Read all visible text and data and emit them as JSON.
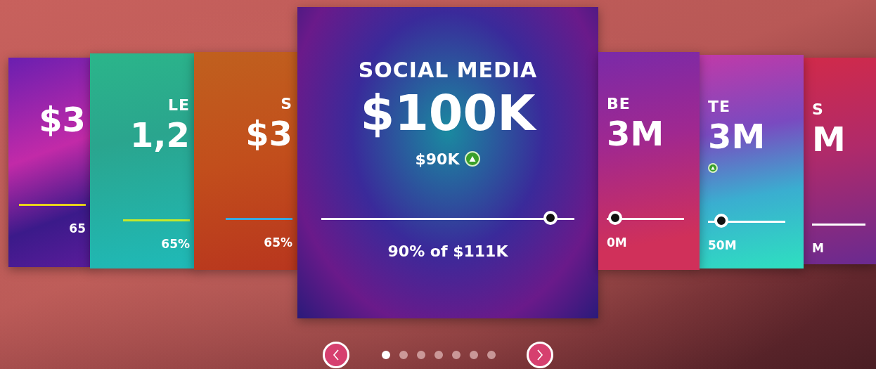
{
  "cards": [
    {
      "kind": "left",
      "value": "$3",
      "up": false,
      "color": "#e8d21c",
      "footer": "65"
    },
    {
      "kind": "left",
      "title": "LE",
      "value": "1,2",
      "up": false,
      "color": "#c6e82a",
      "footer": "65%"
    },
    {
      "kind": "left",
      "title": "S",
      "value": "$3",
      "up": false,
      "color": "#3aa8e0",
      "footer": "65%"
    },
    {
      "kind": "center",
      "title": "SOCIAL MEDIA",
      "value": "$100K",
      "delta": "$90K",
      "up": true,
      "level": 0.93,
      "footer": "90% of $111K"
    },
    {
      "kind": "right",
      "title": "BE",
      "value": "3M",
      "up": false,
      "level": 0.02,
      "footer": "0M"
    },
    {
      "kind": "right",
      "title": "TE",
      "value": "3M",
      "up": true,
      "level": 0.1,
      "footer": "50M"
    },
    {
      "kind": "right",
      "title": "S",
      "value": "M",
      "up": false,
      "footer": "M"
    }
  ],
  "pager": {
    "dots": [
      {
        "selected": true
      },
      {
        "selected": false
      },
      {
        "selected": false
      },
      {
        "selected": false
      },
      {
        "selected": false
      },
      {
        "selected": false
      },
      {
        "selected": false
      }
    ]
  }
}
